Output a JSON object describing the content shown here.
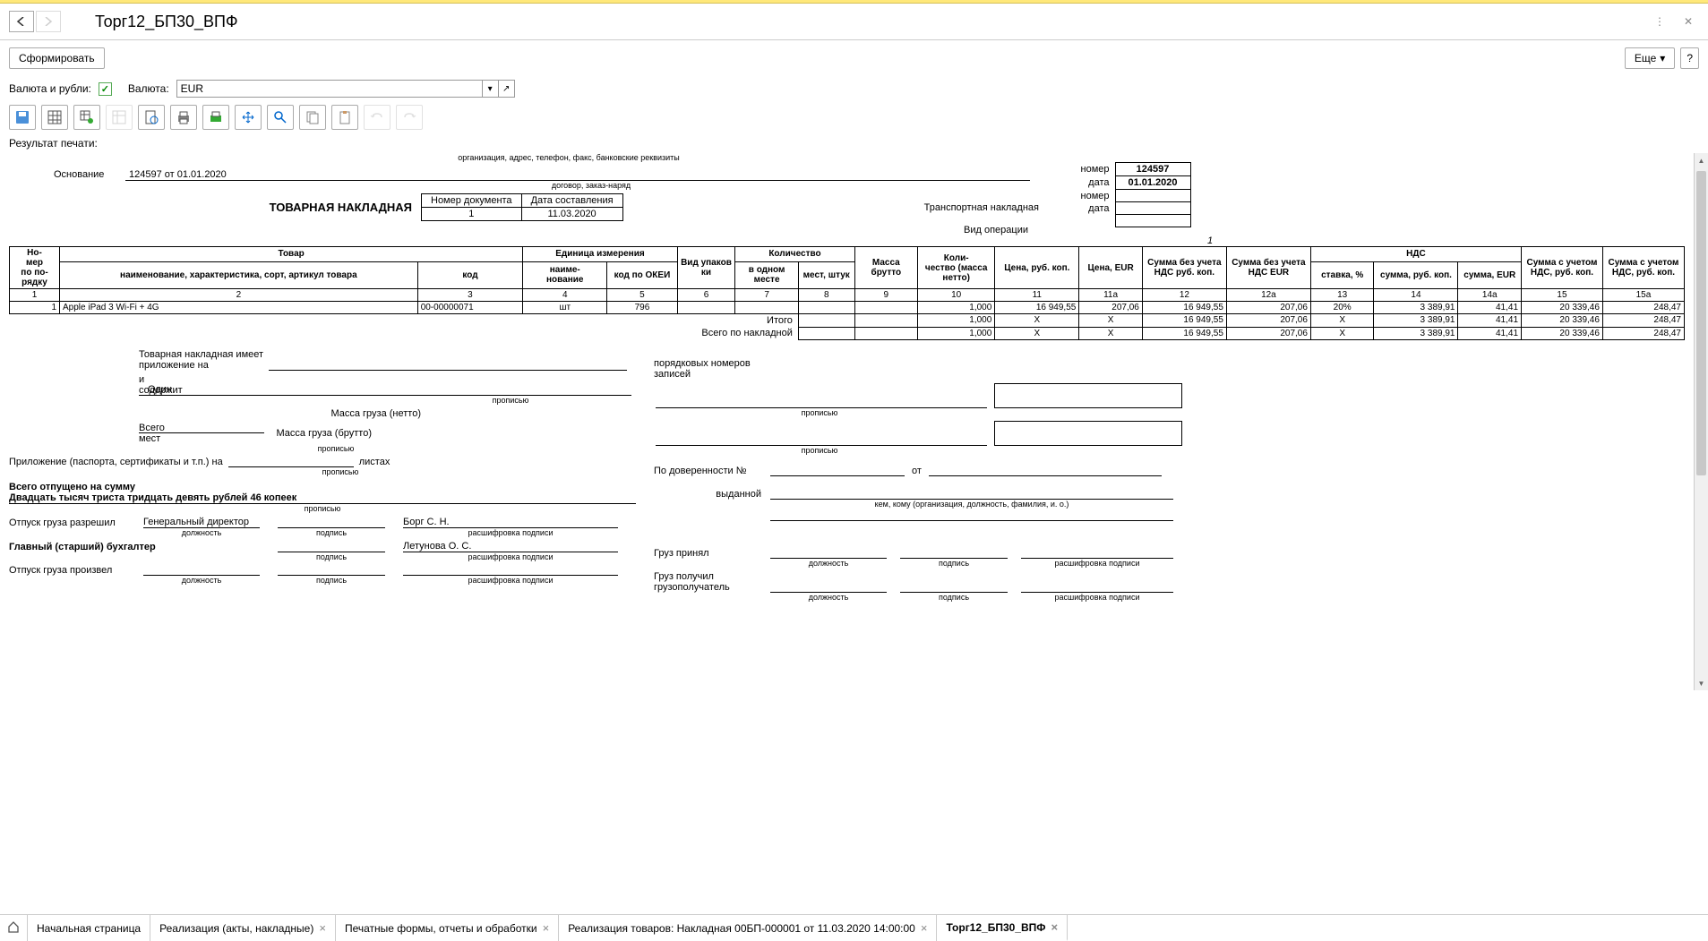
{
  "header": {
    "title": "Торг12_БП30_ВПФ"
  },
  "toolbar": {
    "generate": "Сформировать",
    "more": "Еще",
    "help": "?"
  },
  "currencyRow": {
    "label": "Валюта и рубли:",
    "currencyLbl": "Валюта:",
    "currencyVal": "EUR"
  },
  "resultLabel": "Результат печати:",
  "doc": {
    "orgNote": "организация, адрес, телефон, факс, банковские реквизиты",
    "basisLbl": "Основание",
    "basisVal": "124597 от 01.01.2020",
    "dogNote": "договор, заказ-наряд",
    "title": "ТОВАРНАЯ НАКЛАДНАЯ",
    "docNumHdr": "Номер документа",
    "docDateHdr": "Дата составления",
    "docNum": "1",
    "docDate": "11.03.2020",
    "transp": "Транспортная накладная",
    "vidOp": "Вид операции",
    "nomer": "номер",
    "data": "дата",
    "nomerVal": "124597",
    "dataVal": "01.01.2020",
    "pgnum": "1"
  },
  "table": {
    "hdr": {
      "nom": "Но-\nмер\nпо по-\nрядку",
      "tovar": "Товар",
      "naim": "наименование, характеристика, сорт, артикул товара",
      "kod": "код",
      "ed": "Единица измерения",
      "ednaim": "наиме-\nнование",
      "okei": "код по ОКЕИ",
      "vidup": "Вид упаков\nки",
      "kolvo": "Количество",
      "vodnom": "в одном месте",
      "mest": "мест, штук",
      "massa": "Масса брутто",
      "kolnetto": "Коли-\nчество (масса нетто)",
      "cena": "Цена, руб. коп.",
      "cenaEur": "Цена, EUR",
      "sumbez": "Сумма без учета НДС руб. коп.",
      "sumbezEur": "Сумма без учета НДС EUR",
      "nds": "НДС",
      "stavka": "ставка, %",
      "ndssum": "сумма, руб. коп.",
      "ndssumEur": "сумма, EUR",
      "tot": "Сумма с учетом НДС, руб. коп.",
      "totEur": "Сумма с учетом НДС, руб. коп."
    },
    "colnums": [
      "1",
      "2",
      "3",
      "4",
      "5",
      "6",
      "7",
      "8",
      "9",
      "10",
      "11",
      "11а",
      "12",
      "12а",
      "13",
      "14",
      "14а",
      "15",
      "15а"
    ],
    "rows": [
      {
        "n": "1",
        "name": "Apple iPad 3 Wi-Fi + 4G",
        "code": "00-00000071",
        "ed": "шт",
        "okei": "796",
        "netto": "1,000",
        "cena": "16 949,55",
        "cenaEur": "207,06",
        "sumbez": "16 949,55",
        "sumbezEur": "207,06",
        "stavka": "20%",
        "ndssum": "3 389,91",
        "ndssumEur": "41,41",
        "tot": "20 339,46",
        "totEur": "248,47"
      }
    ],
    "itogo": "Итого",
    "vsego": "Всего по накладной",
    "totals": {
      "netto": "1,000",
      "x": "X",
      "sumbez": "16 949,55",
      "sumbezEur": "207,06",
      "ndssum": "3 389,91",
      "ndssumEur": "41,41",
      "tot": "20 339,46",
      "totEur": "248,47"
    }
  },
  "footer": {
    "l1a": "Товарная накладная имеет приложение на",
    "l2a": "и содержит",
    "l2b": "Один",
    "l2c": "порядковых номеров записей",
    "propis": "прописью",
    "netto": "Масса груза (нетто)",
    "brutto": "Масса груза (брутто)",
    "vsegoMest": "Всего мест",
    "pril": "Приложение (паспорта, сертификаты и т.п.) на",
    "listah": "листах",
    "vsegoOtp": "Всего отпущено  на сумму",
    "summaProp": "Двадцать тысяч триста тридцать девять рублей 46 копеек",
    "otpRazr": "Отпуск груза разрешил",
    "gendir": "Генеральный директор",
    "borg": "Борг С. Н.",
    "glbuh": "Главный (старший) бухгалтер",
    "let": "Летунова О. С.",
    "otpProiz": "Отпуск груза произвел",
    "dolzh": "должность",
    "podpis": "подпись",
    "rasch": "расшифровка подписи",
    "poDov": "По доверенности №",
    "ot": "от",
    "vydan": "выданной",
    "kemkomu": "кем, кому (организация, должность, фамилия, и. о.)",
    "gruzPrin": "Груз принял",
    "gruzPol": "Груз получил грузополучатель"
  },
  "tabs": {
    "home": "Начальная страница",
    "t1": "Реализация (акты, накладные)",
    "t2": "Печатные формы, отчеты и обработки",
    "t3": "Реализация товаров: Накладная 00БП-000001 от 11.03.2020 14:00:00",
    "t4": "Торг12_БП30_ВПФ"
  }
}
